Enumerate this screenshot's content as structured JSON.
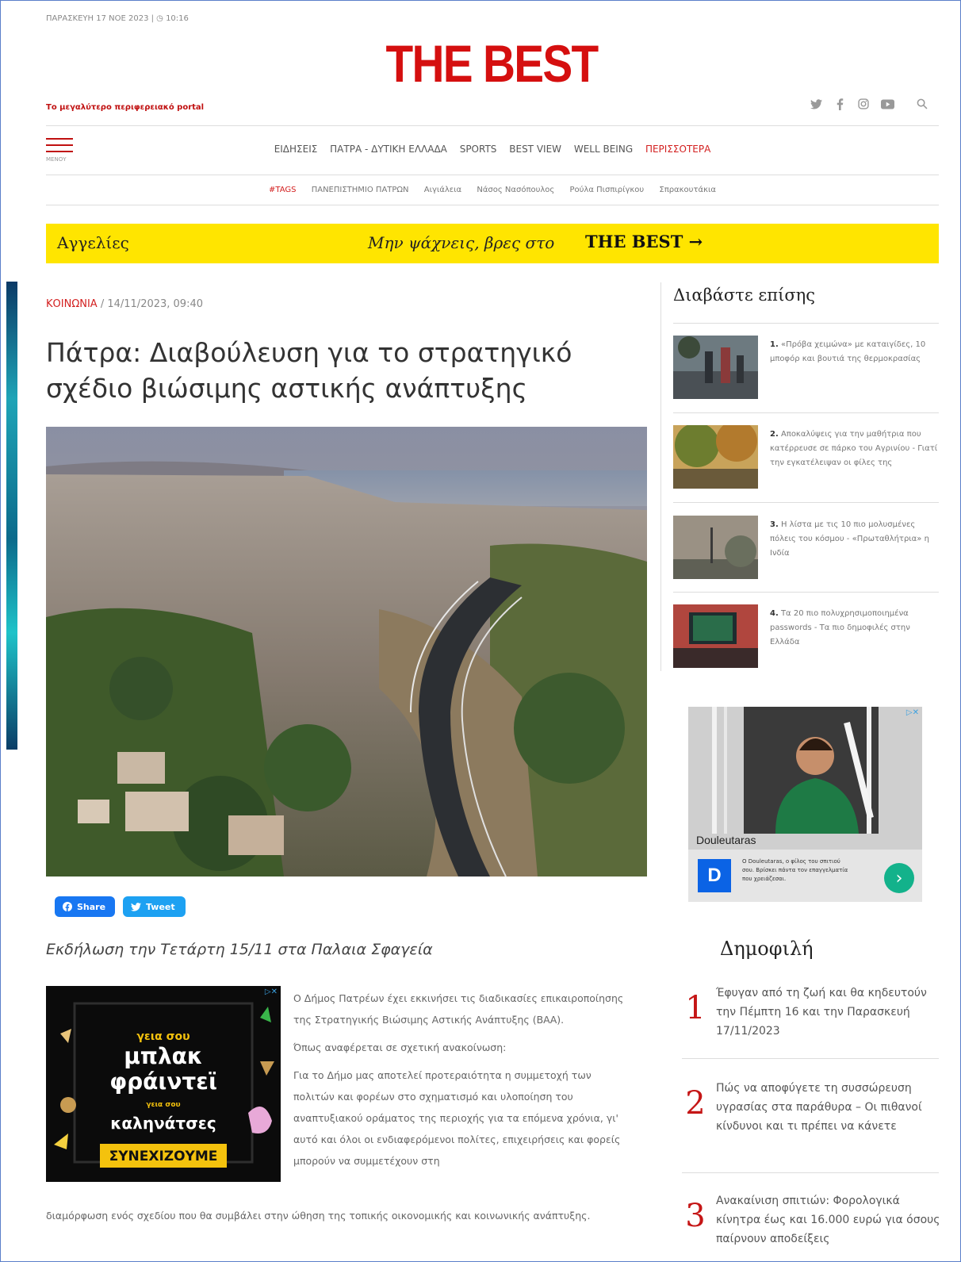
{
  "header": {
    "date": "ΠΑΡΑΣΚΕΥΗ 17 ΝΟΕ 2023 | ◷ 10:16",
    "logo": "THE BEST",
    "tagline": "Το μεγαλύτερο περιφερειακό portal",
    "social_icons": [
      "twitter-icon",
      "facebook-icon",
      "instagram-icon",
      "youtube-icon",
      "search-icon"
    ],
    "menu_label": "ΜΕΝΟΥ"
  },
  "nav": {
    "items": [
      "ΕΙΔΗΣΕΙΣ",
      "ΠΑΤΡΑ - ΔΥΤΙΚΗ ΕΛΛΑΔΑ",
      "SPORTS",
      "BEST VIEW",
      "WELL BEING",
      "ΠΕΡΙΣΣΟΤΕΡΑ"
    ]
  },
  "tags": [
    "#TAGS",
    "ΠΑΝΕΠΙΣΤΗΜΙΟ ΠΑΤΡΩΝ",
    "Αιγιάλεια",
    "Νάσος Νασόπουλος",
    "Ρούλα Πισπιρίγκου",
    "Σπρακουτάκια"
  ],
  "banner": {
    "left": "Αγγελίες",
    "middle": "Μην ψάχνεις, βρες στο",
    "right": "THE BEST →"
  },
  "article": {
    "category": "ΚΟΙΝΩΝΙΑ",
    "datetime": " / 14/11/2023, 09:40",
    "title": "Πάτρα: Διαβούλευση για το στρατηγικό σχέδιο βιώσιμης αστικής ανάπτυξης",
    "share_label": "Share",
    "tweet_label": "Tweet",
    "subtitle": "Εκδήλωση την Τετάρτη 15/11 στα Παλαια Σφαγεία",
    "paragraphs": [
      "Ο Δήμος Πατρέων έχει εκκινήσει τις διαδικασίες επικαιροποίησης της Στρατηγικής Βιώσιμης Αστικής Ανάπτυξης (ΒΑΑ).",
      "Όπως αναφέρεται σε σχετική ανακοίνωση:",
      "Για το Δήμο μας αποτελεί προτεραιότητα η συμμετοχή των πολιτών και φορέων στο σχηματισμό και υλοποίηση του αναπτυξιακού οράματος της περιοχής για τα επόμενα χρόνια, γι' αυτό και όλοι οι ενδιαφερόμενοι πολίτες, επιχειρήσεις και φορείς μπορούν να συμμετέχουν στη"
    ],
    "wide_paragraph": "διαμόρφωση ενός σχεδίου που θα συμβάλει στην ώθηση της τοπικής οικονομικής και κοινωνικής ανάπτυξης."
  },
  "ad_left": {
    "line1": "γεια σου",
    "line2": "μπλακ",
    "line3": "φράιντεϊ",
    "line4": "γεια σου",
    "line5": "καληνάτσες",
    "line6": "ΣΥΝΕΧΙΖΟΥΜΕ"
  },
  "sidebar": {
    "heading": "Διαβάστε επίσης",
    "items": [
      {
        "num": "1.",
        "text": "«Πρόβα χειμώνα» με καταιγίδες, 10 μποφόρ και βουτιά της θερμοκρασίας"
      },
      {
        "num": "2.",
        "text": "Αποκαλύψεις για την μαθήτρια που κατέρρευσε σε πάρκο του Αγρινίου - Γιατί την εγκατέλειψαν οι φίλες της"
      },
      {
        "num": "3.",
        "text": "Η λίστα με τις 10 πιο μολυσμένες πόλεις του κόσμου - «Πρωταθλήτρια» η Ινδία"
      },
      {
        "num": "4.",
        "text": "Τα 20 πιο πολυχρησιμοποιημένα passwords - Τα πιο δημοφιλές στην Ελλάδα"
      }
    ]
  },
  "ad_right": {
    "brand": "Douleutaras",
    "description": "Ο Douleutaras, ο φίλος του σπιτιού σου. Βρίσκει πάντα τον επαγγελματία που χρειάζεσαι."
  },
  "popular": {
    "heading": "Δημοφιλή",
    "items": [
      {
        "num": "1",
        "text": "Έφυγαν από τη ζωή και θα κηδευτούν την Πέμπτη 16 και την Παρασκευή 17/11/2023"
      },
      {
        "num": "2",
        "text": "Πώς να αποφύγετε τη συσσώρευση υγρασίας στα παράθυρα – Οι πιθανοί κίνδυνοι και τι πρέπει να κάνετε"
      },
      {
        "num": "3",
        "text": "Ανακαίνιση σπιτιών: Φορολογικά κίνητρα έως και 16.000 ευρώ για όσους παίρνουν αποδείξεις"
      }
    ]
  }
}
